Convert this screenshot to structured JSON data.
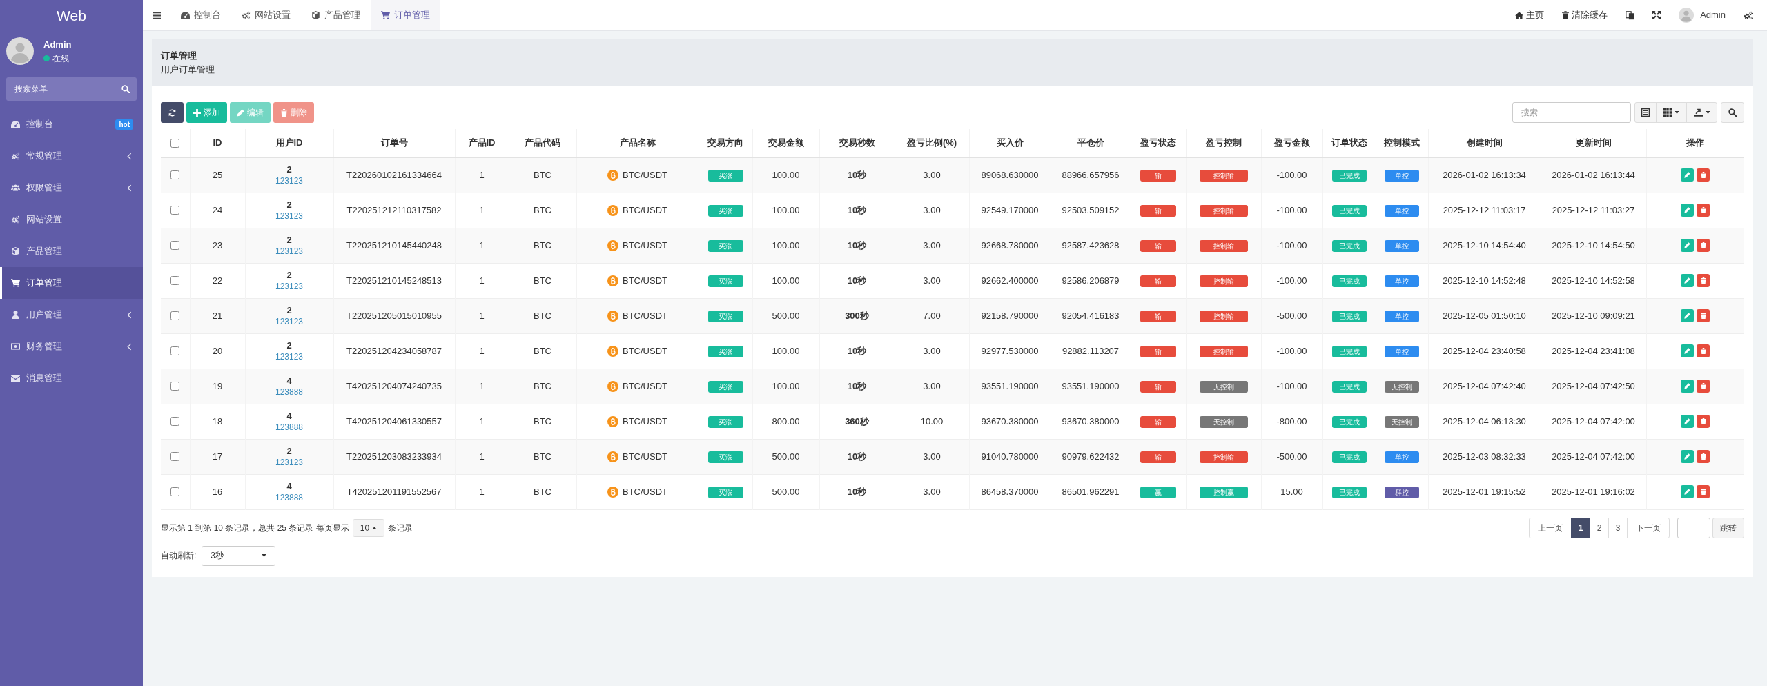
{
  "sidebar": {
    "logo": "Web",
    "user": {
      "name": "Admin",
      "status": "在线"
    },
    "search": {
      "placeholder": "搜索菜单"
    },
    "items": [
      {
        "label": "控制台",
        "badge": "hot",
        "expandable": false,
        "selected": false
      },
      {
        "label": "常规管理",
        "expandable": true,
        "selected": false
      },
      {
        "label": "权限管理",
        "expandable": true,
        "selected": false
      },
      {
        "label": "网站设置",
        "expandable": false,
        "selected": false
      },
      {
        "label": "产品管理",
        "expandable": false,
        "selected": false
      },
      {
        "label": "订单管理",
        "expandable": false,
        "selected": true
      },
      {
        "label": "用户管理",
        "expandable": true,
        "selected": false
      },
      {
        "label": "财务管理",
        "expandable": true,
        "selected": false
      },
      {
        "label": "消息管理",
        "expandable": false,
        "selected": false
      }
    ]
  },
  "navbar": {
    "tabs": [
      {
        "label": "控制台",
        "selected": false
      },
      {
        "label": "网站设置",
        "selected": false
      },
      {
        "label": "产品管理",
        "selected": false
      },
      {
        "label": "订单管理",
        "selected": true
      }
    ],
    "links": [
      {
        "label": "主页"
      },
      {
        "label": "清除缓存"
      }
    ],
    "user": "Admin"
  },
  "page_header": {
    "title": "订单管理",
    "subtitle": "用户订单管理"
  },
  "toolbar": {
    "buttons": [
      {
        "kind": "refresh",
        "disabled": false
      },
      {
        "kind": "add",
        "label": "添加",
        "disabled": false
      },
      {
        "kind": "edit",
        "label": "编辑",
        "disabled": true
      },
      {
        "kind": "delete",
        "label": "删除",
        "disabled": true
      }
    ],
    "search": {
      "placeholder": "搜索"
    }
  },
  "table": {
    "select_all": {
      "checked": false
    },
    "columns": [
      "ID",
      "用户ID",
      "订单号",
      "产品ID",
      "产品代码",
      "产品名称",
      "交易方向",
      "交易金额",
      "交易秒数",
      "盈亏比例(%)",
      "买入价",
      "平仓价",
      "盈亏状态",
      "盈亏控制",
      "盈亏金额",
      "订单状态",
      "控制模式",
      "创建时间",
      "更新时间",
      "操作"
    ],
    "rows": [
      {
        "selected": false,
        "id": "25",
        "user_id": "2",
        "user_name": "123123",
        "order_no": "T220260102161334664",
        "product_id": "1",
        "product_code": "BTC",
        "product_name": "BTC/USDT",
        "direction": "买涨",
        "amount": "100.00",
        "seconds": "10秒",
        "ratio": "3.00",
        "buy_price": "89068.630000",
        "close_price": "88966.657956",
        "pnl_status": {
          "text": "输",
          "color": "#e74c3c"
        },
        "pnl_control": {
          "text": "控制输",
          "color": "#e74c3c"
        },
        "pnl_amount": "-100.00",
        "order_status": "已完成",
        "control_mode": {
          "text": "单控",
          "color": "#2d8cf0"
        },
        "created": "2026-01-02 16:13:34",
        "updated": "2026-01-02 16:13:44"
      },
      {
        "selected": false,
        "id": "24",
        "user_id": "2",
        "user_name": "123123",
        "order_no": "T220251212110317582",
        "product_id": "1",
        "product_code": "BTC",
        "product_name": "BTC/USDT",
        "direction": "买涨",
        "amount": "100.00",
        "seconds": "10秒",
        "ratio": "3.00",
        "buy_price": "92549.170000",
        "close_price": "92503.509152",
        "pnl_status": {
          "text": "输",
          "color": "#e74c3c"
        },
        "pnl_control": {
          "text": "控制输",
          "color": "#e74c3c"
        },
        "pnl_amount": "-100.00",
        "order_status": "已完成",
        "control_mode": {
          "text": "单控",
          "color": "#2d8cf0"
        },
        "created": "2025-12-12 11:03:17",
        "updated": "2025-12-12 11:03:27"
      },
      {
        "selected": false,
        "id": "23",
        "user_id": "2",
        "user_name": "123123",
        "order_no": "T220251210145440248",
        "product_id": "1",
        "product_code": "BTC",
        "product_name": "BTC/USDT",
        "direction": "买涨",
        "amount": "100.00",
        "seconds": "10秒",
        "ratio": "3.00",
        "buy_price": "92668.780000",
        "close_price": "92587.423628",
        "pnl_status": {
          "text": "输",
          "color": "#e74c3c"
        },
        "pnl_control": {
          "text": "控制输",
          "color": "#e74c3c"
        },
        "pnl_amount": "-100.00",
        "order_status": "已完成",
        "control_mode": {
          "text": "单控",
          "color": "#2d8cf0"
        },
        "created": "2025-12-10 14:54:40",
        "updated": "2025-12-10 14:54:50"
      },
      {
        "selected": false,
        "id": "22",
        "user_id": "2",
        "user_name": "123123",
        "order_no": "T220251210145248513",
        "product_id": "1",
        "product_code": "BTC",
        "product_name": "BTC/USDT",
        "direction": "买涨",
        "amount": "100.00",
        "seconds": "10秒",
        "ratio": "3.00",
        "buy_price": "92662.400000",
        "close_price": "92586.206879",
        "pnl_status": {
          "text": "输",
          "color": "#e74c3c"
        },
        "pnl_control": {
          "text": "控制输",
          "color": "#e74c3c"
        },
        "pnl_amount": "-100.00",
        "order_status": "已完成",
        "control_mode": {
          "text": "单控",
          "color": "#2d8cf0"
        },
        "created": "2025-12-10 14:52:48",
        "updated": "2025-12-10 14:52:58"
      },
      {
        "selected": false,
        "id": "21",
        "user_id": "2",
        "user_name": "123123",
        "order_no": "T220251205015010955",
        "product_id": "1",
        "product_code": "BTC",
        "product_name": "BTC/USDT",
        "direction": "买涨",
        "amount": "500.00",
        "seconds": "300秒",
        "ratio": "7.00",
        "buy_price": "92158.790000",
        "close_price": "92054.416183",
        "pnl_status": {
          "text": "输",
          "color": "#e74c3c"
        },
        "pnl_control": {
          "text": "控制输",
          "color": "#e74c3c"
        },
        "pnl_amount": "-500.00",
        "order_status": "已完成",
        "control_mode": {
          "text": "单控",
          "color": "#2d8cf0"
        },
        "created": "2025-12-05 01:50:10",
        "updated": "2025-12-10 09:09:21"
      },
      {
        "selected": false,
        "id": "20",
        "user_id": "2",
        "user_name": "123123",
        "order_no": "T220251204234058787",
        "product_id": "1",
        "product_code": "BTC",
        "product_name": "BTC/USDT",
        "direction": "买涨",
        "amount": "100.00",
        "seconds": "10秒",
        "ratio": "3.00",
        "buy_price": "92977.530000",
        "close_price": "92882.113207",
        "pnl_status": {
          "text": "输",
          "color": "#e74c3c"
        },
        "pnl_control": {
          "text": "控制输",
          "color": "#e74c3c"
        },
        "pnl_amount": "-100.00",
        "order_status": "已完成",
        "control_mode": {
          "text": "单控",
          "color": "#2d8cf0"
        },
        "created": "2025-12-04 23:40:58",
        "updated": "2025-12-04 23:41:08"
      },
      {
        "selected": false,
        "id": "19",
        "user_id": "4",
        "user_name": "123888",
        "order_no": "T420251204074240735",
        "product_id": "1",
        "product_code": "BTC",
        "product_name": "BTC/USDT",
        "direction": "买涨",
        "amount": "100.00",
        "seconds": "10秒",
        "ratio": "3.00",
        "buy_price": "93551.190000",
        "close_price": "93551.190000",
        "pnl_status": {
          "text": "输",
          "color": "#e74c3c"
        },
        "pnl_control": {
          "text": "无控制",
          "color": "#777777"
        },
        "pnl_amount": "-100.00",
        "order_status": "已完成",
        "control_mode": {
          "text": "无控制",
          "color": "#777777"
        },
        "created": "2025-12-04 07:42:40",
        "updated": "2025-12-04 07:42:50"
      },
      {
        "selected": false,
        "id": "18",
        "user_id": "4",
        "user_name": "123888",
        "order_no": "T420251204061330557",
        "product_id": "1",
        "product_code": "BTC",
        "product_name": "BTC/USDT",
        "direction": "买涨",
        "amount": "800.00",
        "seconds": "360秒",
        "ratio": "10.00",
        "buy_price": "93670.380000",
        "close_price": "93670.380000",
        "pnl_status": {
          "text": "输",
          "color": "#e74c3c"
        },
        "pnl_control": {
          "text": "无控制",
          "color": "#777777"
        },
        "pnl_amount": "-800.00",
        "order_status": "已完成",
        "control_mode": {
          "text": "无控制",
          "color": "#777777"
        },
        "created": "2025-12-04 06:13:30",
        "updated": "2025-12-04 07:42:00"
      },
      {
        "selected": false,
        "id": "17",
        "user_id": "2",
        "user_name": "123123",
        "order_no": "T220251203083233934",
        "product_id": "1",
        "product_code": "BTC",
        "product_name": "BTC/USDT",
        "direction": "买涨",
        "amount": "500.00",
        "seconds": "10秒",
        "ratio": "3.00",
        "buy_price": "91040.780000",
        "close_price": "90979.622432",
        "pnl_status": {
          "text": "输",
          "color": "#e74c3c"
        },
        "pnl_control": {
          "text": "控制输",
          "color": "#e74c3c"
        },
        "pnl_amount": "-500.00",
        "order_status": "已完成",
        "control_mode": {
          "text": "单控",
          "color": "#2d8cf0"
        },
        "created": "2025-12-03 08:32:33",
        "updated": "2025-12-04 07:42:00"
      },
      {
        "selected": false,
        "id": "16",
        "user_id": "4",
        "user_name": "123888",
        "order_no": "T420251201191552567",
        "product_id": "1",
        "product_code": "BTC",
        "product_name": "BTC/USDT",
        "direction": "买涨",
        "amount": "500.00",
        "seconds": "10秒",
        "ratio": "3.00",
        "buy_price": "86458.370000",
        "close_price": "86501.962291",
        "pnl_status": {
          "text": "赢",
          "color": "#18bc9c"
        },
        "pnl_control": {
          "text": "控制赢",
          "color": "#18bc9c"
        },
        "pnl_amount": "15.00",
        "order_status": "已完成",
        "control_mode": {
          "text": "群控",
          "color": "#605ca8"
        },
        "created": "2025-12-01 19:15:52",
        "updated": "2025-12-01 19:16:02"
      }
    ]
  },
  "footer": {
    "summary": "显示第 1 到第 10 条记录，总共 25 条记录 每页显示",
    "page_size": "10",
    "suffix": "条记录",
    "pagination": {
      "prev": "上一页",
      "pages": [
        {
          "label": "1",
          "selected": true
        },
        {
          "label": "2",
          "selected": false
        },
        {
          "label": "3",
          "selected": false
        }
      ],
      "next": "下一页",
      "jump": "跳转"
    },
    "auto_refresh": {
      "label": "自动刷新:",
      "value": "3秒"
    }
  }
}
